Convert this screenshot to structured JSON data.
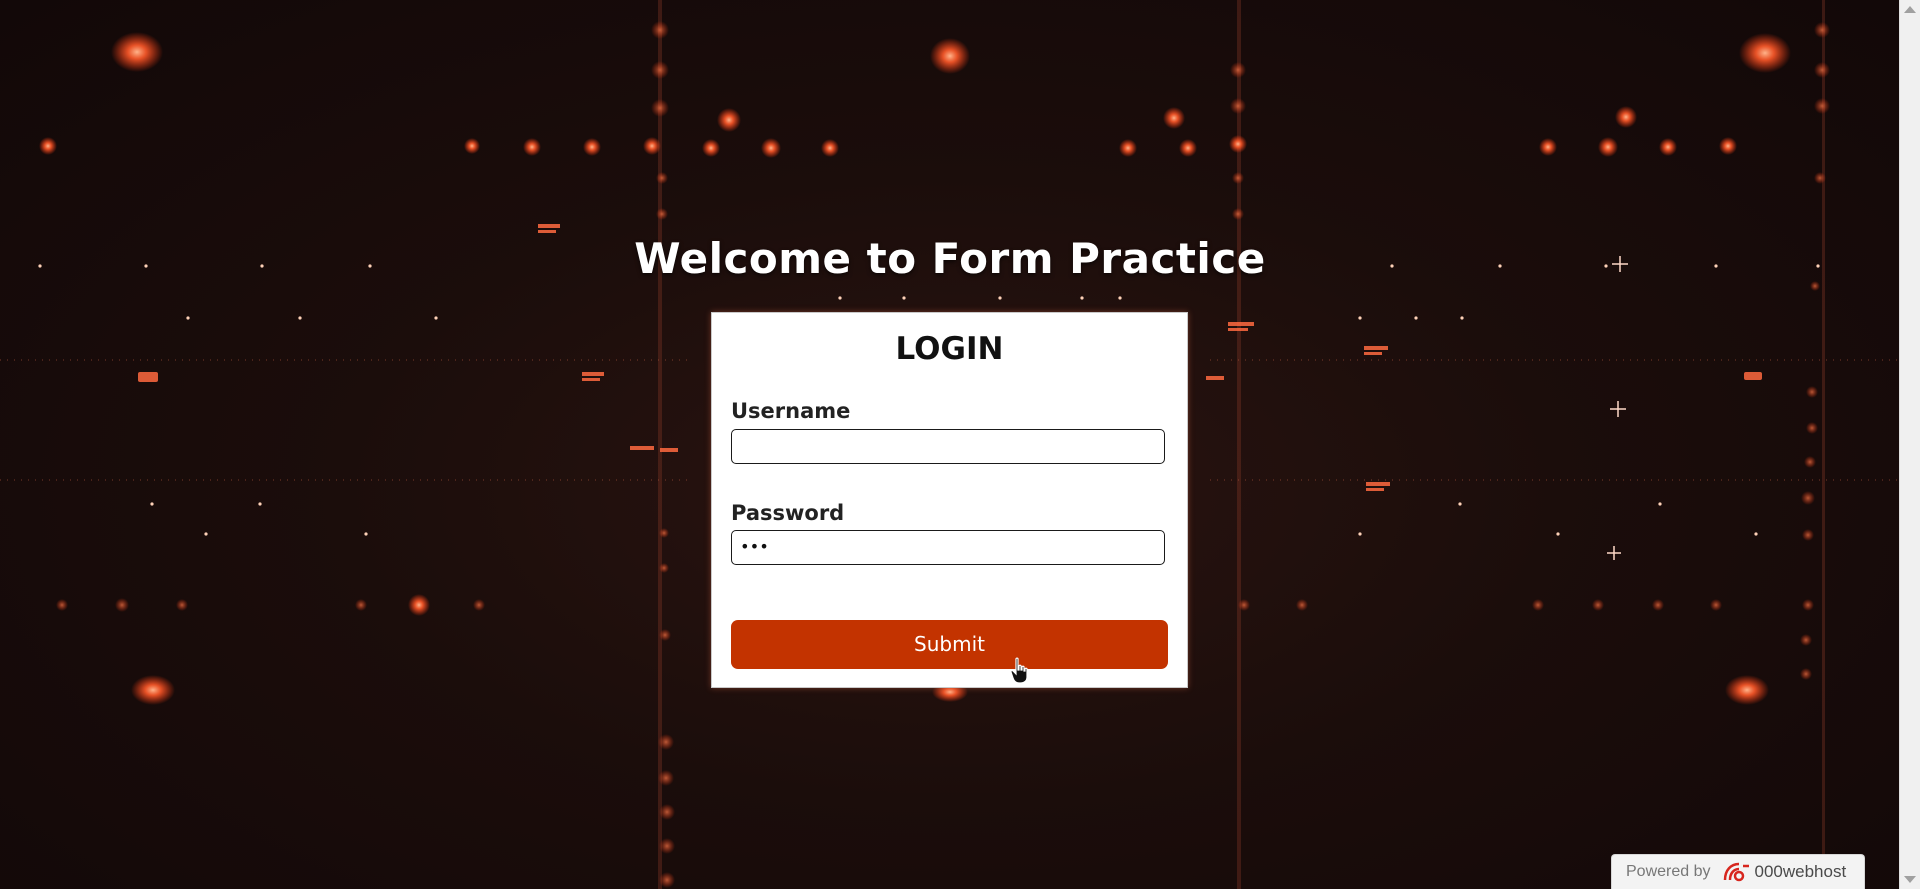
{
  "page": {
    "heading": "Welcome to Form Practice"
  },
  "login": {
    "title": "LOGIN",
    "username_label": "Username",
    "username_value": "",
    "password_label": "Password",
    "password_value": "•••",
    "submit_label": "Submit"
  },
  "footer": {
    "powered_by": "Powered by",
    "brand": "000webhost"
  },
  "colors": {
    "accent": "#c33300",
    "background": "#1a0e0c",
    "glow": "#ff5a2a"
  },
  "icons": {
    "cursor": "hand-pointer-icon",
    "brand_logo": "000webhost-logo-icon"
  }
}
